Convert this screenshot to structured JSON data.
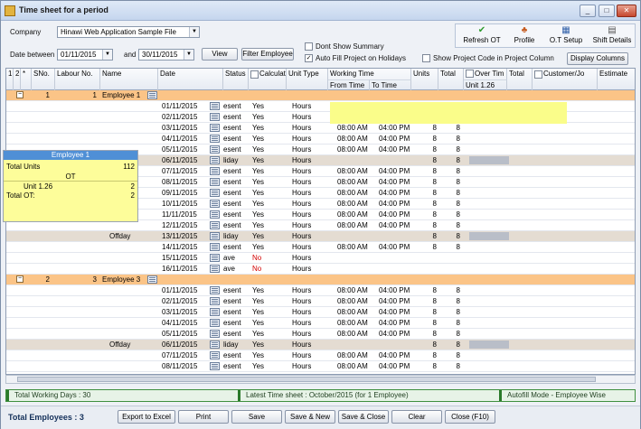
{
  "window": {
    "title": "Time sheet for a period",
    "controls": [
      "_",
      "□",
      "✕"
    ]
  },
  "toolbar": {
    "company_label": "Company",
    "company_value": "Hinawi Web Application Sample File",
    "date_between_label": "Date between",
    "date_from": "01/11/2015",
    "and_label": "and",
    "date_to": "30/11/2015",
    "view_label": "View",
    "filter_employee_label": "Filter Employee",
    "dont_show_summary": "Dont Show Summary",
    "auto_fill_project": "Auto Fill Project on Holidays",
    "show_project_code": "Show Project Code in Project Column",
    "display_columns": "Display Columns",
    "refresh_ot": "Refresh OT",
    "profile": "Profile",
    "ot_setup": "O.T Setup",
    "shift_details": "Shift Details"
  },
  "grid": {
    "headers": {
      "c1": "1",
      "c2": "2",
      "star": "*",
      "sno": "SNo.",
      "labour": "Labour No.",
      "name": "Name",
      "date": "Date",
      "status": "Status",
      "calc": "Calculat",
      "unit_type": "Unit Type",
      "working_time": "Working Time",
      "from": "From Time",
      "to": "To Time",
      "units": "Units",
      "total": "Total",
      "over_time": "Over Tim",
      "unit126": "Unit 1.26",
      "total2": "Total",
      "customer": "Customer/Jo",
      "estimate": "Estimate"
    },
    "group1": {
      "sno": "1",
      "labour": "1",
      "name": "Employee 1"
    },
    "group2": {
      "sno": "2",
      "labour": "3",
      "name": "Employee 3"
    },
    "rows_emp1": [
      {
        "date": "01/11/2015",
        "status": "esent",
        "calc": "Yes",
        "ut": "Hours",
        "from": "08:00 AM",
        "to": "08:00 PM",
        "units": "8",
        "total": "8",
        "ot": "2",
        "ot_total": "2"
      },
      {
        "date": "02/11/2015",
        "status": "esent",
        "calc": "Yes",
        "ut": "Hours",
        "from": "08:00 AM",
        "to": "04:00 PM",
        "units": "8",
        "total": "8"
      },
      {
        "date": "03/11/2015",
        "status": "esent",
        "calc": "Yes",
        "ut": "Hours",
        "from": "08:00 AM",
        "to": "04:00 PM",
        "units": "8",
        "total": "8"
      },
      {
        "date": "04/11/2015",
        "status": "esent",
        "calc": "Yes",
        "ut": "Hours",
        "from": "08:00 AM",
        "to": "04:00 PM",
        "units": "8",
        "total": "8"
      },
      {
        "date": "05/11/2015",
        "status": "esent",
        "calc": "Yes",
        "ut": "Hours",
        "from": "08:00 AM",
        "to": "04:00 PM",
        "units": "8",
        "total": "8"
      },
      {
        "date": "06/11/2015",
        "status": "liday",
        "calc": "Yes",
        "ut": "Hours",
        "from": "",
        "to": "",
        "units": "8",
        "total": "8",
        "hol": true
      },
      {
        "date": "07/11/2015",
        "status": "esent",
        "calc": "Yes",
        "ut": "Hours",
        "from": "08:00 AM",
        "to": "04:00 PM",
        "units": "8",
        "total": "8"
      },
      {
        "date": "08/11/2015",
        "status": "esent",
        "calc": "Yes",
        "ut": "Hours",
        "from": "08:00 AM",
        "to": "04:00 PM",
        "units": "8",
        "total": "8"
      },
      {
        "date": "09/11/2015",
        "status": "esent",
        "calc": "Yes",
        "ut": "Hours",
        "from": "08:00 AM",
        "to": "04:00 PM",
        "units": "8",
        "total": "8"
      },
      {
        "date": "10/11/2015",
        "status": "esent",
        "calc": "Yes",
        "ut": "Hours",
        "from": "08:00 AM",
        "to": "04:00 PM",
        "units": "8",
        "total": "8"
      },
      {
        "date": "11/11/2015",
        "status": "esent",
        "calc": "Yes",
        "ut": "Hours",
        "from": "08:00 AM",
        "to": "04:00 PM",
        "units": "8",
        "total": "8"
      },
      {
        "date": "12/11/2015",
        "status": "esent",
        "calc": "Yes",
        "ut": "Hours",
        "from": "08:00 AM",
        "to": "04:00 PM",
        "units": "8",
        "total": "8"
      },
      {
        "date": "13/11/2015",
        "status": "liday",
        "calc": "Yes",
        "ut": "Hours",
        "from": "",
        "to": "",
        "units": "8",
        "total": "8",
        "hol": true,
        "name": "Offday"
      },
      {
        "date": "14/11/2015",
        "status": "esent",
        "calc": "Yes",
        "ut": "Hours",
        "from": "08:00 AM",
        "to": "04:00 PM",
        "units": "8",
        "total": "8"
      },
      {
        "date": "15/11/2015",
        "status": "ave",
        "calc": "No",
        "ut": "Hours",
        "from": "",
        "to": "",
        "units": "",
        "total": ""
      },
      {
        "date": "16/11/2015",
        "status": "ave",
        "calc": "No",
        "ut": "Hours",
        "from": "",
        "to": "",
        "units": "",
        "total": ""
      }
    ],
    "rows_emp3": [
      {
        "date": "01/11/2015",
        "status": "esent",
        "calc": "Yes",
        "ut": "Hours",
        "from": "08:00 AM",
        "to": "04:00 PM",
        "units": "8",
        "total": "8"
      },
      {
        "date": "02/11/2015",
        "status": "esent",
        "calc": "Yes",
        "ut": "Hours",
        "from": "08:00 AM",
        "to": "04:00 PM",
        "units": "8",
        "total": "8"
      },
      {
        "date": "03/11/2015",
        "status": "esent",
        "calc": "Yes",
        "ut": "Hours",
        "from": "08:00 AM",
        "to": "04:00 PM",
        "units": "8",
        "total": "8"
      },
      {
        "date": "04/11/2015",
        "status": "esent",
        "calc": "Yes",
        "ut": "Hours",
        "from": "08:00 AM",
        "to": "04:00 PM",
        "units": "8",
        "total": "8"
      },
      {
        "date": "05/11/2015",
        "status": "esent",
        "calc": "Yes",
        "ut": "Hours",
        "from": "08:00 AM",
        "to": "04:00 PM",
        "units": "8",
        "total": "8"
      },
      {
        "date": "06/11/2015",
        "status": "liday",
        "calc": "Yes",
        "ut": "Hours",
        "from": "",
        "to": "",
        "units": "8",
        "total": "8",
        "hol": true,
        "name": "Offday"
      },
      {
        "date": "07/11/2015",
        "status": "esent",
        "calc": "Yes",
        "ut": "Hours",
        "from": "08:00 AM",
        "to": "04:00 PM",
        "units": "8",
        "total": "8"
      },
      {
        "date": "08/11/2015",
        "status": "esent",
        "calc": "Yes",
        "ut": "Hours",
        "from": "08:00 AM",
        "to": "04:00 PM",
        "units": "8",
        "total": "8"
      }
    ]
  },
  "popup": {
    "title": "Employee 1",
    "total_units_label": "Total Units",
    "total_units_value": "112",
    "ot_label": "OT",
    "unit_label": "Unit 1.26",
    "unit_value": "2",
    "total_ot_label": "Total OT:",
    "total_ot_value": "2"
  },
  "status": {
    "working_days": "Total Working Days : 30",
    "latest_timesheet": "Latest Time sheet : October/2015 (for 1 Employee)",
    "autofill_mode": "Autofill Mode - Employee Wise"
  },
  "bottom": {
    "total_employees": "Total Employees : 3",
    "export": "Export to Excel",
    "print": "Print",
    "save": "Save",
    "save_new": "Save & New",
    "save_close": "Save & Close",
    "clear": "Clear",
    "close": "Close (F10)"
  }
}
